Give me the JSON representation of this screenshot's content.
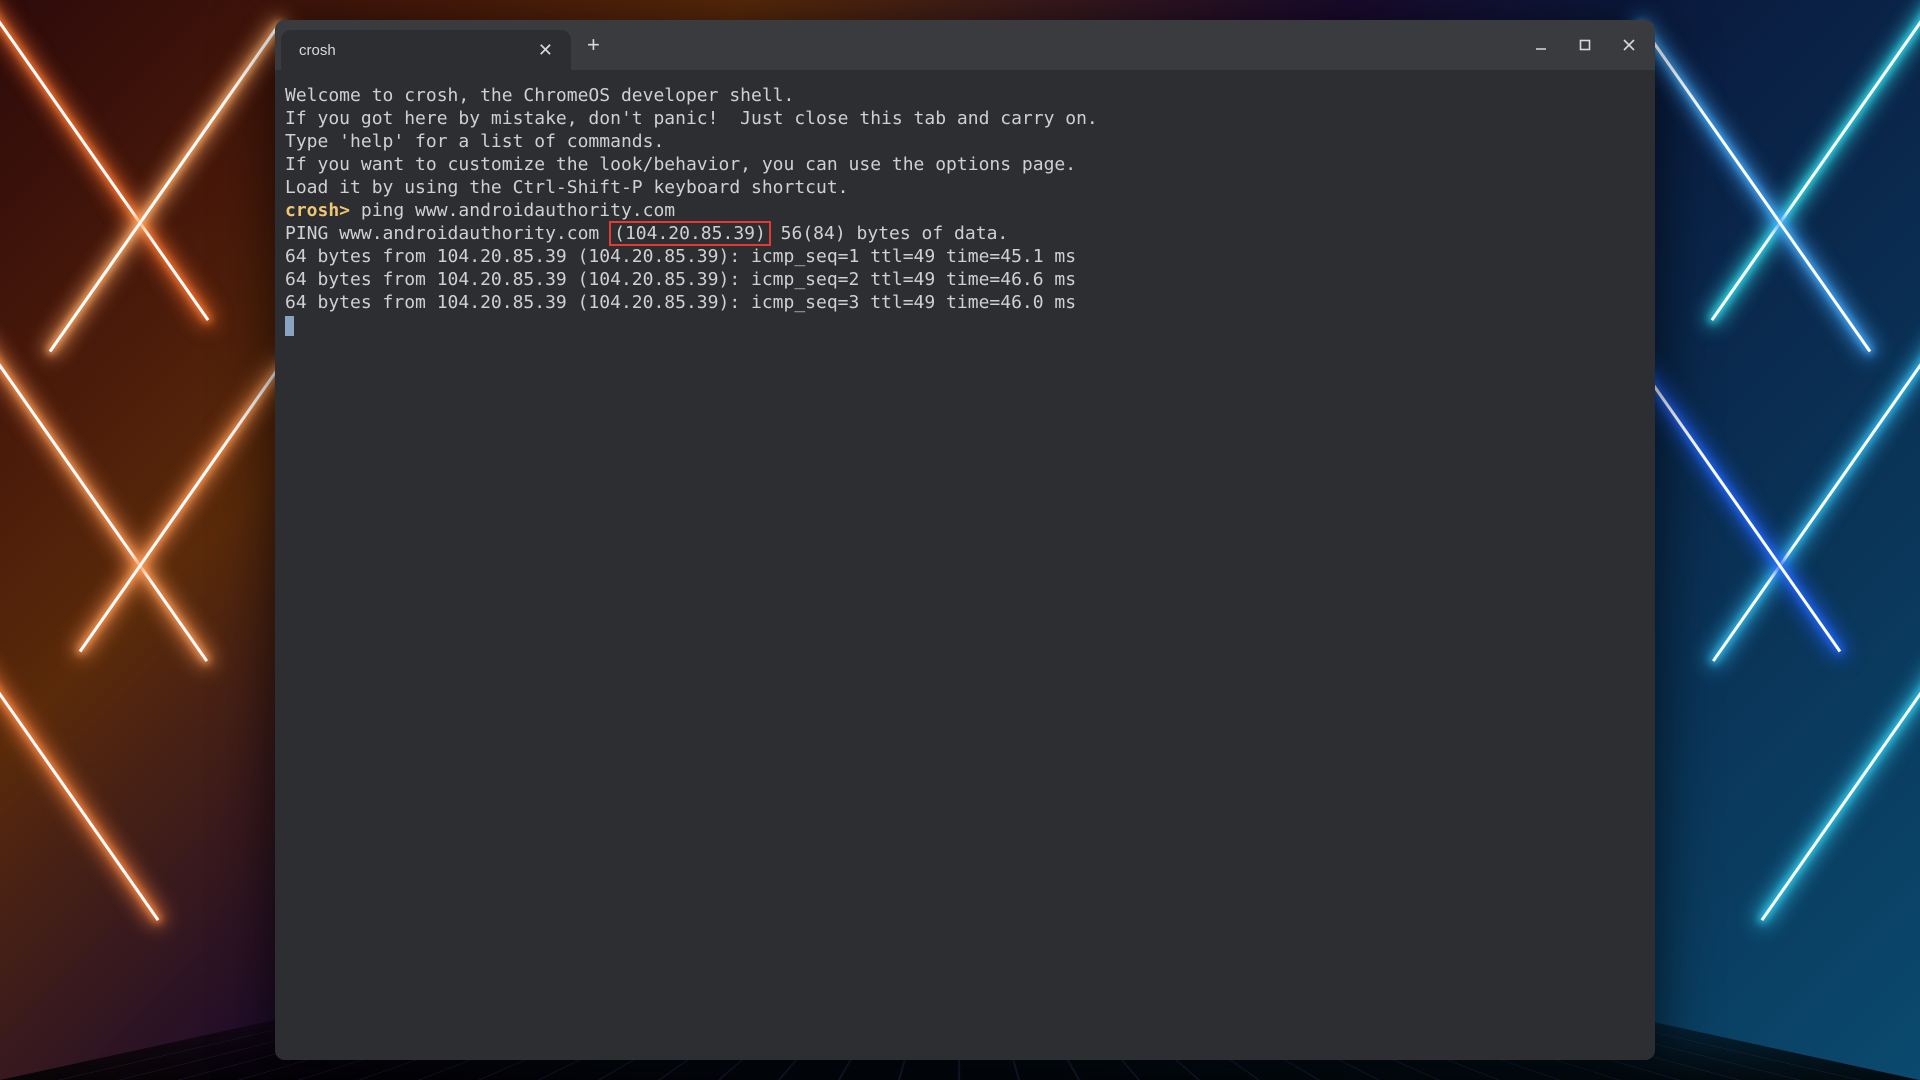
{
  "window": {
    "tab_title": "crosh",
    "controls": {
      "minimize": "minimize",
      "maximize": "maximize",
      "close": "close"
    }
  },
  "terminal": {
    "welcome_lines": [
      "Welcome to crosh, the ChromeOS developer shell.",
      "",
      "If you got here by mistake, don't panic!  Just close this tab and carry on.",
      "",
      "Type 'help' for a list of commands.",
      "",
      "If you want to customize the look/behavior, you can use the options page.",
      "Load it by using the Ctrl-Shift-P keyboard shortcut.",
      ""
    ],
    "prompt": "crosh>",
    "command": " ping www.androidauthority.com",
    "ping_header_pre": "PING www.androidauthority.com ",
    "ping_ip_highlight": "(104.20.85.39)",
    "ping_header_post": " 56(84) bytes of data.",
    "ping_replies": [
      "64 bytes from 104.20.85.39 (104.20.85.39): icmp_seq=1 ttl=49 time=45.1 ms",
      "64 bytes from 104.20.85.39 (104.20.85.39): icmp_seq=2 ttl=49 time=46.6 ms",
      "64 bytes from 104.20.85.39 (104.20.85.39): icmp_seq=3 ttl=49 time=46.0 ms"
    ]
  }
}
